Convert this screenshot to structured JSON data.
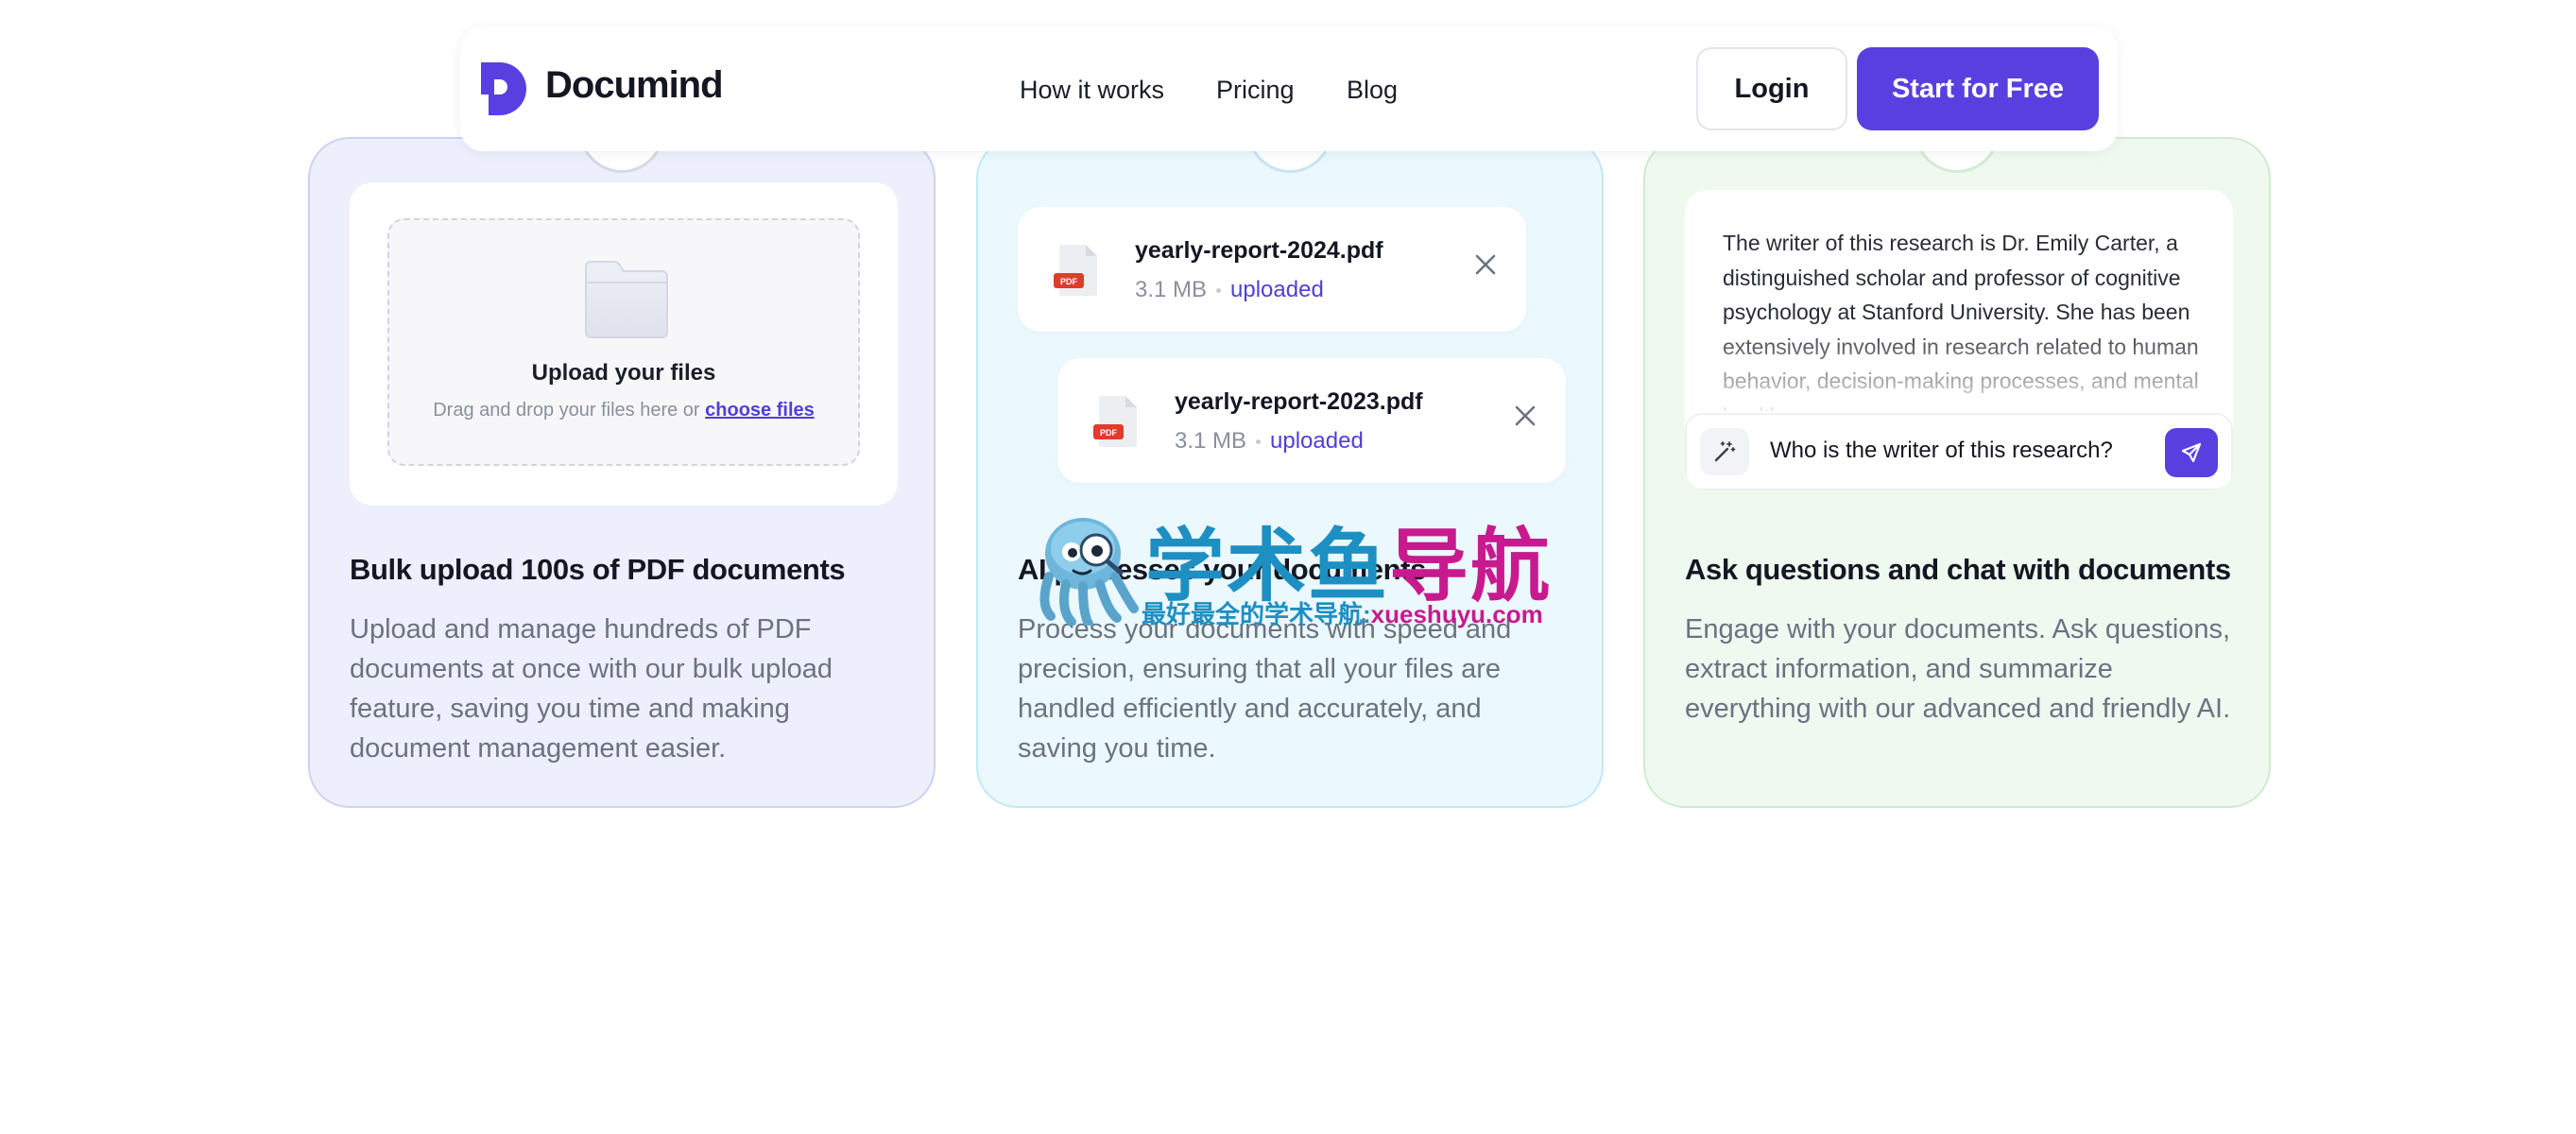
{
  "brand": {
    "name": "Documind",
    "accent": "#5a3fe0"
  },
  "nav": {
    "links": [
      "How it works",
      "Pricing",
      "Blog"
    ],
    "login_label": "Login",
    "start_label": "Start for Free"
  },
  "cards": [
    {
      "title": "Bulk upload 100s of PDF documents",
      "description": "Upload and manage hundreds of PDF documents at once with our bulk upload feature, saving you time and making document management easier.",
      "upload": {
        "title": "Upload your files",
        "subtitle": "Drag and drop your files here or",
        "link": "choose files"
      }
    },
    {
      "title": "AI processes your documents",
      "description": "Process your documents with speed and precision, ensuring that all your files are handled efficiently and accurately, and saving you time.",
      "files": [
        {
          "name": "yearly-report-2024.pdf",
          "size": "3.1 MB",
          "status": "uploaded",
          "icon_label": "PDF"
        },
        {
          "name": "yearly-report-2023.pdf",
          "size": "3.1 MB",
          "status": "uploaded",
          "icon_label": "PDF"
        }
      ]
    },
    {
      "title": "Ask questions and chat with documents",
      "description": "Engage with your documents. Ask questions, extract information, and summarize everything with our advanced and friendly AI.",
      "chat": {
        "answer": "The writer of this research is Dr. Emily Carter, a distinguished scholar and professor of cognitive psychology at Stanford University. She has been extensively involved in research related to human behavior, decision-making processes, and mental health.",
        "question": "Who is the writer of this research?"
      }
    }
  ],
  "watermark": {
    "title_part1": "学术鱼",
    "title_part2": "导航",
    "subtitle_part1": "最好最全的学术导航:",
    "subtitle_part2": "xueshuyu.com"
  }
}
